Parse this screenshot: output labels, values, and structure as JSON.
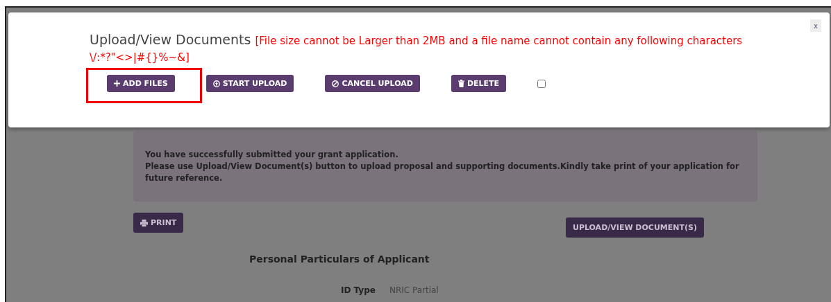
{
  "modal": {
    "title": "Upload/View Documents",
    "warning": "[File size cannot be Larger than 2MB and a file name cannot contain any following characters \\/:*?\"<>|#{}%~&]",
    "close": "x",
    "buttons": [
      {
        "kind": "add",
        "label": "ADD FILES",
        "highlighted": true
      },
      {
        "kind": "start",
        "label": "START UPLOAD",
        "highlighted": false
      },
      {
        "kind": "cancel",
        "label": "CANCEL UPLOAD",
        "highlighted": false
      },
      {
        "kind": "delete",
        "label": "DELETE",
        "highlighted": false
      }
    ],
    "select_all": {
      "checked": false
    }
  },
  "notice": {
    "lines": [
      "You have successfully submitted your grant application.",
      "Please use Upload/View Document(s) button to upload proposal and supporting documents.Kindly take print of your application for future reference."
    ]
  },
  "print_button": "PRINT",
  "upload_button": "UPLOAD/VIEW DOCUMENT(S)",
  "section_title": "Personal Particulars of Applicant",
  "fields": [
    {
      "label": "ID Type",
      "value": "NRIC Partial"
    }
  ]
}
